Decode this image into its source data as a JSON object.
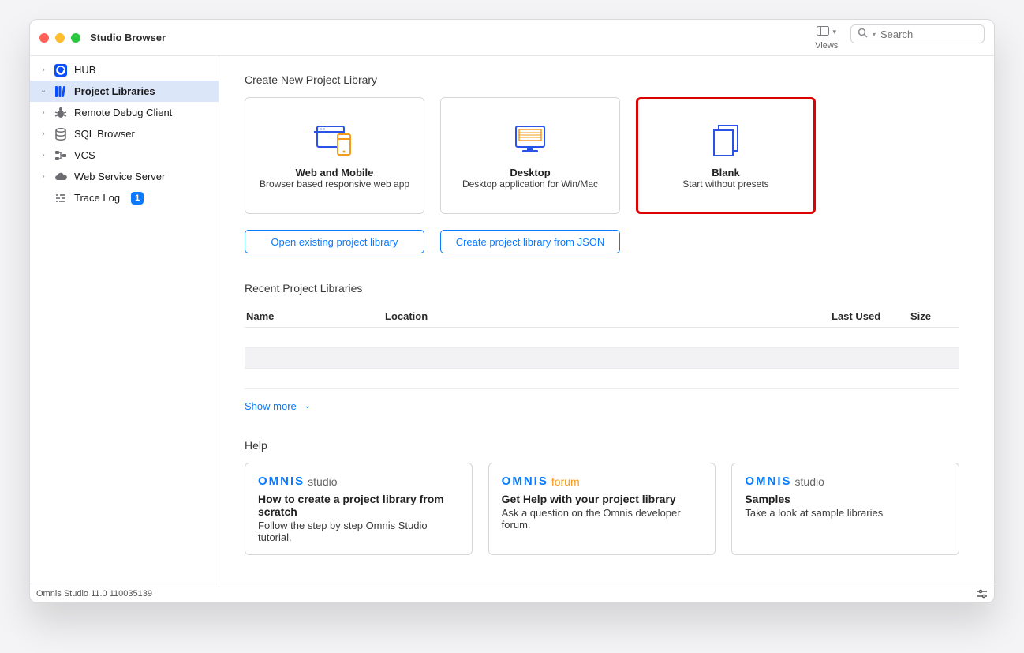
{
  "window": {
    "title": "Studio Browser"
  },
  "toolbar": {
    "views_label": "Views",
    "search_placeholder": "Search"
  },
  "sidebar": {
    "items": [
      {
        "label": "HUB",
        "expandable": true,
        "open": false
      },
      {
        "label": "Project Libraries",
        "expandable": true,
        "open": true,
        "selected": true
      },
      {
        "label": "Remote Debug Client",
        "expandable": true,
        "open": false
      },
      {
        "label": "SQL Browser",
        "expandable": true,
        "open": false
      },
      {
        "label": "VCS",
        "expandable": true,
        "open": false
      },
      {
        "label": "Web Service Server",
        "expandable": true,
        "open": false
      },
      {
        "label": "Trace Log",
        "badge": "1"
      }
    ]
  },
  "main": {
    "create_title": "Create New Project Library",
    "cards": [
      {
        "title": "Web and Mobile",
        "subtitle": "Browser based responsive web app",
        "icon": "web-mobile"
      },
      {
        "title": "Desktop",
        "subtitle": "Desktop application for Win/Mac",
        "icon": "desktop"
      },
      {
        "title": "Blank",
        "subtitle": "Start without presets",
        "icon": "blank",
        "highlight": true
      }
    ],
    "actions": [
      {
        "label": "Open existing project library"
      },
      {
        "label": "Create project library from JSON"
      }
    ],
    "recent_title": "Recent Project Libraries",
    "columns": {
      "name": "Name",
      "location": "Location",
      "last_used": "Last Used",
      "size": "Size"
    },
    "show_more": "Show more",
    "help_title": "Help",
    "help_cards": [
      {
        "brand_sub": "studio",
        "title": "How to create a project library from scratch",
        "desc": "Follow the step by step Omnis Studio tutorial."
      },
      {
        "brand_sub": "forum",
        "title": "Get Help with your project library",
        "desc": "Ask a question on the Omnis developer forum."
      },
      {
        "brand_sub": "studio",
        "title": "Samples",
        "desc": "Take a look at sample libraries"
      }
    ]
  },
  "statusbar": {
    "text": "Omnis Studio 11.0 110035139"
  }
}
